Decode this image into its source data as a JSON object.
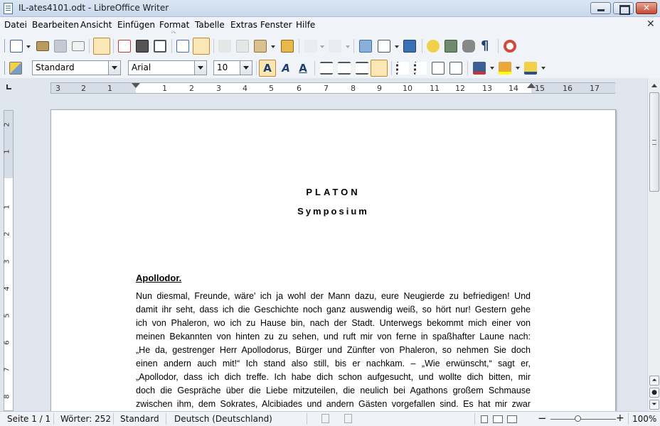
{
  "window": {
    "title": "IL-ates4101.odt - LibreOffice Writer"
  },
  "menubar": {
    "items": [
      "Datei",
      "Bearbeiten",
      "Ansicht",
      "Einfügen",
      "Format",
      "Tabelle",
      "Extras",
      "Fenster",
      "Hilfe"
    ]
  },
  "formatting": {
    "paragraph_style": "Standard",
    "font_name": "Arial",
    "font_size": "10"
  },
  "ruler": {
    "numbers": [
      "3",
      "2",
      "1",
      "1",
      "2",
      "3",
      "4",
      "5",
      "6",
      "7",
      "8",
      "9",
      "10",
      "11",
      "12",
      "13",
      "14",
      "15",
      "16",
      "17"
    ],
    "vertical_numbers": [
      "2",
      "1",
      "1",
      "2",
      "3",
      "4",
      "5",
      "6",
      "7",
      "8"
    ]
  },
  "document": {
    "title": "PLATON",
    "subtitle": "Symposium",
    "speaker": "Apollodor.",
    "lines": [
      "Nun diesmal, Freunde, wäre' ich ja wohl der Mann dazu, eure Neugierde zu befriedigen! Und",
      "damit ihr seht, dass ich die Geschichte noch ganz auswendig weiß, so hört nur! Gestern gehe",
      "ich von Phaleron, wo ich zu Hause bin, nach der Stadt. Unterwegs bekommt mich einer von",
      "meinen Bekannten von hinten zu zu sehen, und ruft mir von ferne in spaßhafter Laune nach:",
      "„He da, gestrenger Herr Apollodorus, Bürger und Zünfter von Phaleron, so nehmen Sie doch",
      "einen andern auch mit!“ Ich stand also still, bis er nachkam. – „Wie erwünscht,“ sagt er,",
      "„Apollodor, dass ich dich treffe. Ich habe dich schon aufgesucht, und wollte dich bitten, mir",
      "doch die Gespräche über die Liebe mitzuteilen, die neulich bei Agathons großem Schmause",
      "zwischen ihm, dem Sokrates, Alcibiades und andern Gästen vorgefallen sind. Es hat mir zwar"
    ]
  },
  "statusbar": {
    "page": "Seite 1 / 1",
    "words": "Wörter: 252",
    "style": "Standard",
    "language": "Deutsch (Deutschland)",
    "zoom": "100%"
  },
  "icons": [
    "new-document-icon",
    "open-icon",
    "save-icon",
    "email-icon",
    "edit-mode-icon",
    "export-pdf-icon",
    "print-icon",
    "print-preview-icon",
    "spellcheck-icon",
    "autospellcheck-icon",
    "cut-icon",
    "copy-icon",
    "paste-icon",
    "clone-formatting-icon",
    "undo-icon",
    "redo-icon",
    "hyperlink-icon",
    "table-icon",
    "draw-functions-icon",
    "navigator-icon",
    "gallery-icon",
    "data-sources-icon",
    "formatting-marks-icon",
    "help-icon"
  ]
}
